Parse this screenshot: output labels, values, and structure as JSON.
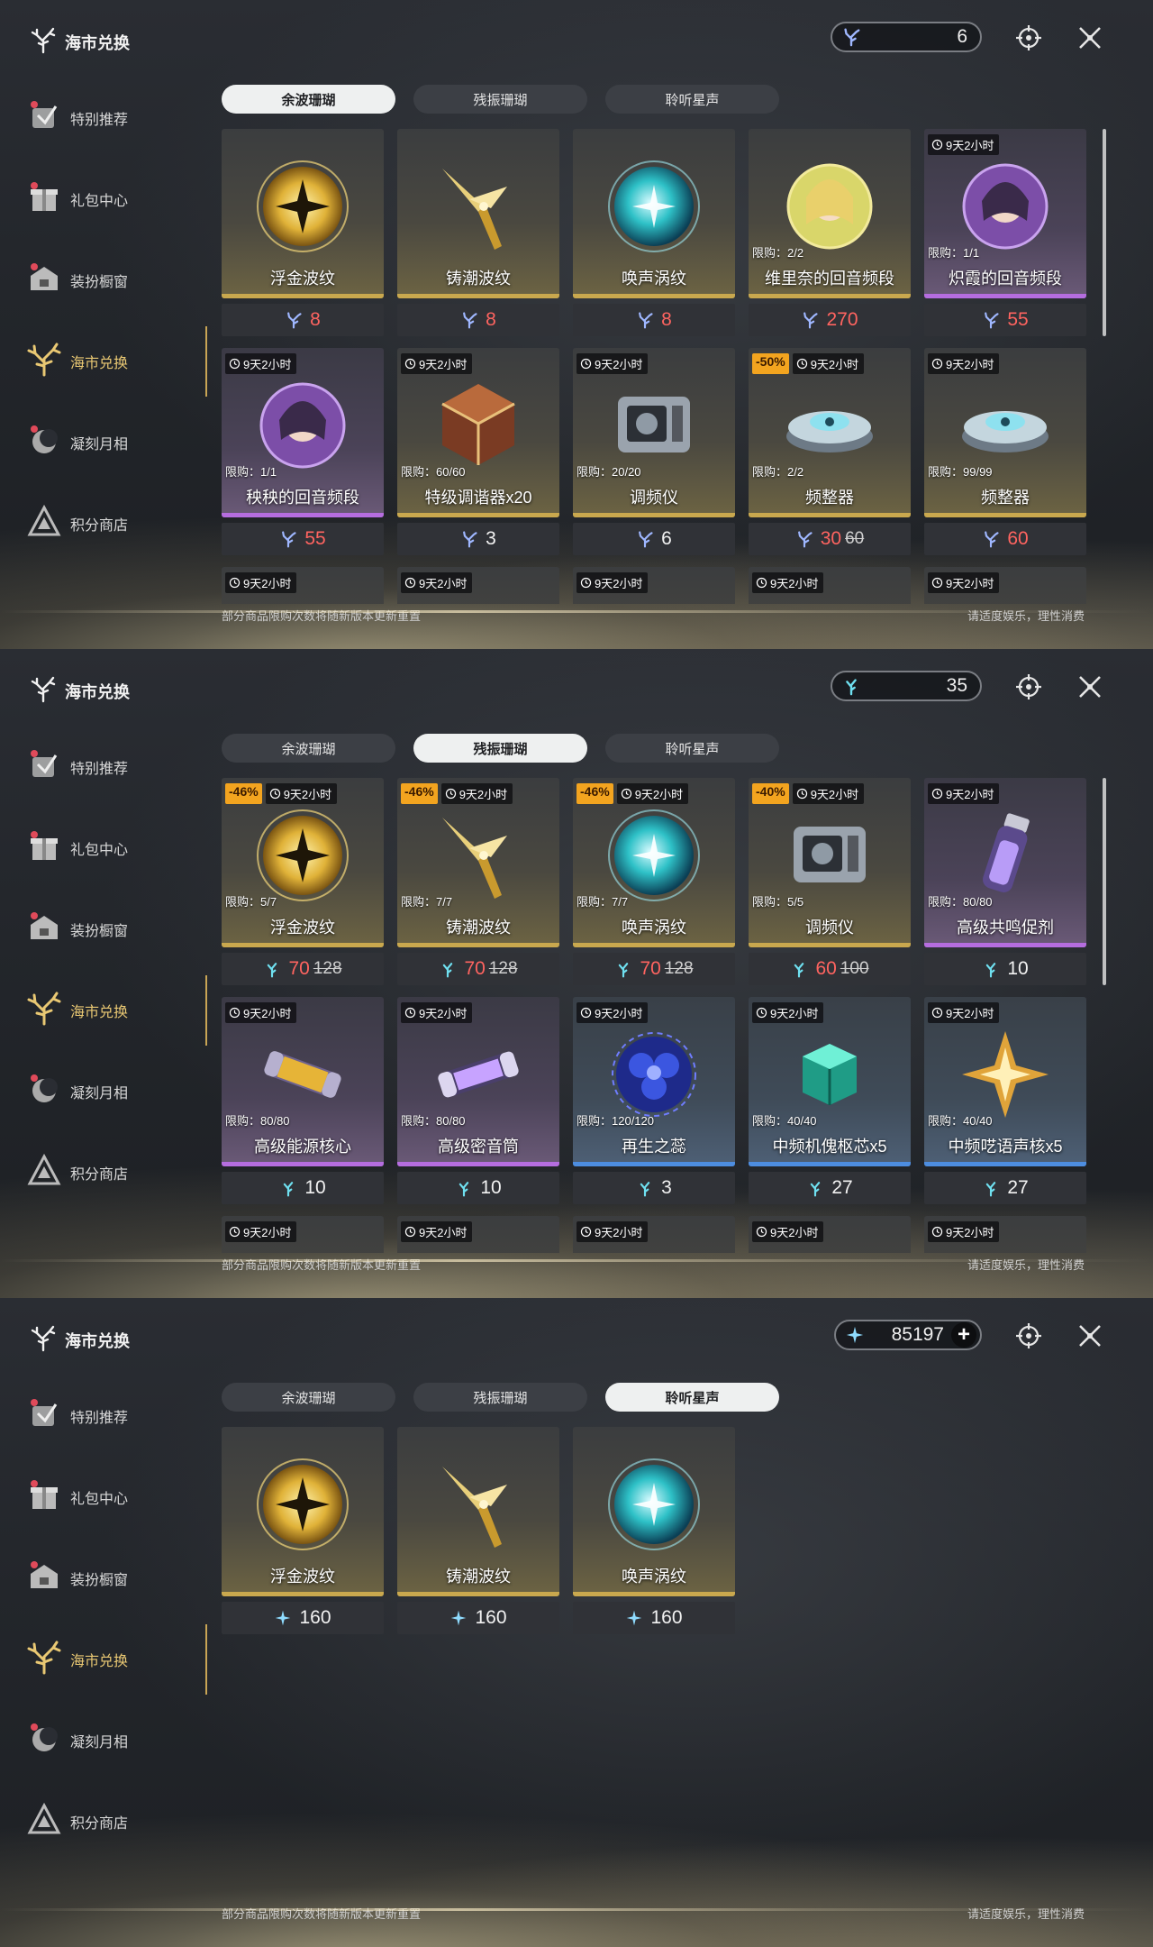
{
  "app_title": "海市兑换",
  "footer_left": "部分商品限购次数将随新版本更新重置",
  "footer_right": "请适度娱乐，理性消费",
  "colors": {
    "accent_gold": "#c9a84e",
    "price_red": "#ff6460",
    "discount": "#f3a41f",
    "rarity_purple": "#b56ddf",
    "rarity_blue": "#4d8de0"
  },
  "sidebar": [
    {
      "label": "特别推荐",
      "icon": "recommend-icon"
    },
    {
      "label": "礼包中心",
      "icon": "gift-icon"
    },
    {
      "label": "装扮橱窗",
      "icon": "wardrobe-icon"
    },
    {
      "label": "海市兑换",
      "icon": "coral-icon",
      "active": true
    },
    {
      "label": "凝刻月相",
      "icon": "moon-icon"
    },
    {
      "label": "积分商店",
      "icon": "points-icon"
    }
  ],
  "tabs": [
    "余波珊瑚",
    "残振珊瑚",
    "聆听星声"
  ],
  "panels": [
    {
      "active_tab": 0,
      "currency": {
        "icon": "afterglow-coral-icon",
        "value": "6",
        "plus": false
      },
      "items": [
        {
          "name": "浮金波纹",
          "art": "golden-orb",
          "rarity": "gold",
          "price": "8",
          "price_color": "red"
        },
        {
          "name": "铸潮波纹",
          "art": "gold-dagger",
          "rarity": "gold",
          "price": "8",
          "price_color": "red"
        },
        {
          "name": "唤声涡纹",
          "art": "teal-orb",
          "rarity": "gold",
          "price": "8",
          "price_color": "red"
        },
        {
          "name": "维里奈的回音频段",
          "art": "portrait-gold",
          "rarity": "gold",
          "limit": "限购：2/2",
          "price": "270",
          "price_color": "red"
        },
        {
          "name": "炽霞的回音频段",
          "art": "portrait-purple",
          "rarity": "purple",
          "time": "9天2小时",
          "limit": "限购：1/1",
          "price": "55",
          "price_color": "red"
        },
        {
          "name": "秧秧的回音频段",
          "art": "portrait-purple",
          "rarity": "purple",
          "time": "9天2小时",
          "limit": "限购：1/1",
          "price": "55",
          "price_color": "red"
        },
        {
          "name": "特级调谐器x20",
          "art": "tuner-die",
          "rarity": "gold",
          "time": "9天2小时",
          "limit": "限购：60/60",
          "price": "3",
          "price_color": "white"
        },
        {
          "name": "调频仪",
          "art": "device",
          "rarity": "gold",
          "time": "9天2小时",
          "limit": "限购：20/20",
          "price": "6",
          "price_color": "white"
        },
        {
          "name": "频整器",
          "art": "disc",
          "rarity": "gold",
          "discount": "-50%",
          "time": "9天2小时",
          "limit": "限购：2/2",
          "price": "30",
          "old_price": "60",
          "price_color": "red"
        },
        {
          "name": "频整器",
          "art": "disc",
          "rarity": "gold",
          "time": "9天2小时",
          "limit": "限购：99/99",
          "price": "60",
          "price_color": "red"
        },
        {
          "time": "9天2小时",
          "partial": true
        },
        {
          "time": "9天2小时",
          "partial": true
        },
        {
          "time": "9天2小时",
          "partial": true
        },
        {
          "time": "9天2小时",
          "partial": true
        },
        {
          "time": "9天2小时",
          "partial": true
        }
      ],
      "scrollbar": true
    },
    {
      "active_tab": 1,
      "currency": {
        "icon": "resonance-coral-icon",
        "value": "35",
        "plus": false
      },
      "items": [
        {
          "name": "浮金波纹",
          "art": "golden-orb",
          "rarity": "gold",
          "discount": "-46%",
          "time": "9天2小时",
          "limit": "限购：5/7",
          "price": "70",
          "old_price": "128",
          "price_color": "red"
        },
        {
          "name": "铸潮波纹",
          "art": "gold-dagger",
          "rarity": "gold",
          "discount": "-46%",
          "time": "9天2小时",
          "limit": "限购：7/7",
          "price": "70",
          "old_price": "128",
          "price_color": "red"
        },
        {
          "name": "唤声涡纹",
          "art": "teal-orb",
          "rarity": "gold",
          "discount": "-46%",
          "time": "9天2小时",
          "limit": "限购：7/7",
          "price": "70",
          "old_price": "128",
          "price_color": "red"
        },
        {
          "name": "调频仪",
          "art": "device",
          "rarity": "gold",
          "discount": "-40%",
          "time": "9天2小时",
          "limit": "限购：5/5",
          "price": "60",
          "old_price": "100",
          "price_color": "red"
        },
        {
          "name": "高级共鸣促剂",
          "art": "vial",
          "rarity": "purple",
          "time": "9天2小时",
          "limit": "限购：80/80",
          "price": "10",
          "price_color": "white"
        },
        {
          "name": "高级能源核心",
          "art": "capsule-gold",
          "rarity": "purple",
          "time": "9天2小时",
          "limit": "限购：80/80",
          "price": "10",
          "price_color": "white"
        },
        {
          "name": "高级密音筒",
          "art": "capsule-purple",
          "rarity": "purple",
          "time": "9天2小时",
          "limit": "限购：80/80",
          "price": "10",
          "price_color": "white"
        },
        {
          "name": "再生之蕊",
          "art": "blue-flower",
          "rarity": "blue",
          "time": "9天2小时",
          "limit": "限购：120/120",
          "price": "3",
          "price_color": "white"
        },
        {
          "name": "中频机傀枢芯x5",
          "art": "green-cube",
          "rarity": "blue",
          "time": "9天2小时",
          "limit": "限购：40/40",
          "price": "27",
          "price_color": "white"
        },
        {
          "name": "中频呓语声核x5",
          "art": "gold-star",
          "rarity": "blue",
          "time": "9天2小时",
          "limit": "限购：40/40",
          "price": "27",
          "price_color": "white"
        },
        {
          "time": "9天2小时",
          "partial": true
        },
        {
          "time": "9天2小时",
          "partial": true
        },
        {
          "time": "9天2小时",
          "partial": true
        },
        {
          "time": "9天2小时",
          "partial": true
        },
        {
          "time": "9天2小时",
          "partial": true
        }
      ],
      "scrollbar": true
    },
    {
      "active_tab": 2,
      "currency": {
        "icon": "star-voice-icon",
        "value": "85197",
        "plus": true
      },
      "items": [
        {
          "name": "浮金波纹",
          "art": "golden-orb",
          "rarity": "gold",
          "price": "160",
          "price_color": "white"
        },
        {
          "name": "铸潮波纹",
          "art": "gold-dagger",
          "rarity": "gold",
          "price": "160",
          "price_color": "white"
        },
        {
          "name": "唤声涡纹",
          "art": "teal-orb",
          "rarity": "gold",
          "price": "160",
          "price_color": "white"
        }
      ],
      "scrollbar": false
    }
  ]
}
